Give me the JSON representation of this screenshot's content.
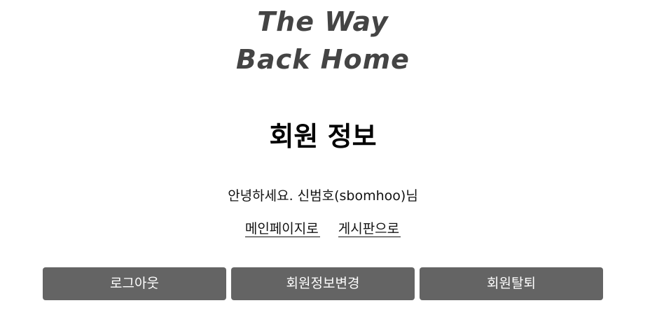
{
  "logo": {
    "line1": "The Way",
    "line2": "Back Home"
  },
  "page_title": "회원 정보",
  "greeting": "안녕하세요. 신범호(sbomhoo)님",
  "links": {
    "main_page": "메인페이지로",
    "board": "게시판으로"
  },
  "buttons": {
    "logout": "로그아웃",
    "edit_profile": "회원정보변경",
    "withdraw": "회원탈퇴"
  },
  "colors": {
    "button_bg": "#646464",
    "logo_text": "#444444"
  }
}
